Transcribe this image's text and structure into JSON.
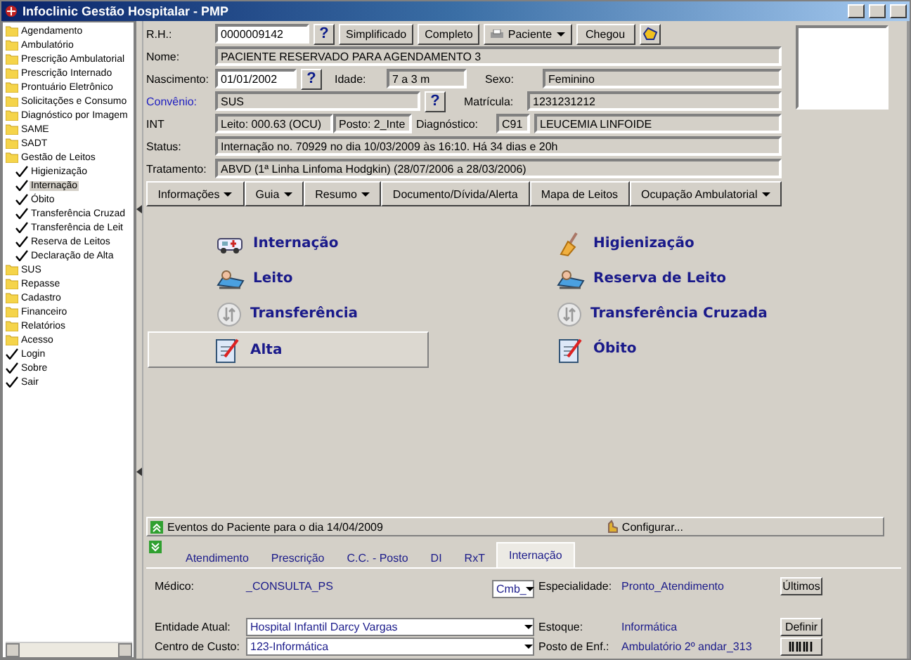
{
  "window": {
    "title": "Infoclinic Gestão Hospitalar - PMP"
  },
  "sidebar": {
    "items": [
      {
        "label": "Agendamento",
        "kind": "folder",
        "selected": false
      },
      {
        "label": "Ambulatório",
        "kind": "folder",
        "selected": false
      },
      {
        "label": "Prescrição Ambulatorial",
        "kind": "folder",
        "selected": false
      },
      {
        "label": "Prescrição Internado",
        "kind": "folder",
        "selected": false
      },
      {
        "label": "Prontuário Eletrônico",
        "kind": "folder",
        "selected": false
      },
      {
        "label": "Solicitações e Consumo",
        "kind": "folder",
        "selected": false
      },
      {
        "label": "Diagnóstico por Imagem",
        "kind": "folder",
        "selected": false
      },
      {
        "label": "SAME",
        "kind": "folder",
        "selected": false
      },
      {
        "label": "SADT",
        "kind": "folder",
        "selected": false
      },
      {
        "label": "Gestão de Leitos",
        "kind": "folder",
        "selected": false,
        "children": [
          {
            "label": "Higienização",
            "kind": "action",
            "selected": false
          },
          {
            "label": "Internação",
            "kind": "action",
            "selected": true
          },
          {
            "label": "Óbito",
            "kind": "action",
            "selected": false
          },
          {
            "label": "Transferência Cruzad",
            "kind": "action",
            "selected": false
          },
          {
            "label": "Transferência de Leit",
            "kind": "action",
            "selected": false
          },
          {
            "label": "Reserva de Leitos",
            "kind": "action",
            "selected": false
          },
          {
            "label": "Declaração de Alta",
            "kind": "action",
            "selected": false
          }
        ]
      },
      {
        "label": "SUS",
        "kind": "folder",
        "selected": false
      },
      {
        "label": "Repasse",
        "kind": "folder",
        "selected": false
      },
      {
        "label": "Cadastro",
        "kind": "folder",
        "selected": false
      },
      {
        "label": "Financeiro",
        "kind": "folder",
        "selected": false
      },
      {
        "label": "Relatórios",
        "kind": "folder",
        "selected": false
      },
      {
        "label": "Acesso",
        "kind": "folder",
        "selected": false
      },
      {
        "label": "Login",
        "kind": "action",
        "selected": false
      },
      {
        "label": "Sobre",
        "kind": "action",
        "selected": false
      },
      {
        "label": "Sair",
        "kind": "action",
        "selected": false
      }
    ]
  },
  "patient": {
    "rh_label": "R.H.:",
    "rh": "0000009142",
    "help": "?",
    "buttons": {
      "simplified": "Simplificado",
      "complete": "Completo",
      "patient": "Paciente",
      "arrived": "Chegou"
    },
    "name_label": "Nome:",
    "name": "PACIENTE RESERVADO PARA AGENDAMENTO 3",
    "birth_label": "Nascimento:",
    "birth": "01/01/2002",
    "age_label": "Idade:",
    "age": "7 a 3 m",
    "sex_label": "Sexo:",
    "sex": "Feminino",
    "insurance_label": "Convênio:",
    "insurance": "SUS",
    "registration_label": "Matrícula:",
    "registration": "1231231212",
    "int_label": "INT",
    "bed": "Leito: 000.63 (OCU)",
    "post": "Posto: 2_Inte",
    "diagnosis_label": "Diagnóstico:",
    "diagnosis_code": "C91",
    "diagnosis": "LEUCEMIA LINFOIDE",
    "status_label": "Status:",
    "status": "Internação no. 70929 no dia 10/03/2009  às  16:10. Há 34 dias e 20h",
    "treatment_label": "Tratamento:",
    "treatment": "ABVD (1ª Linha Linfoma Hodgkin) (28/07/2006 a 28/03/2006)"
  },
  "toolbar": [
    {
      "label": "Informações",
      "dropdown": true
    },
    {
      "label": "Guia",
      "dropdown": true
    },
    {
      "label": "Resumo",
      "dropdown": true
    },
    {
      "label": "Documento/Dívida/Alerta",
      "dropdown": false
    },
    {
      "label": "Mapa de Leitos",
      "dropdown": false
    },
    {
      "label": "Ocupação Ambulatorial",
      "dropdown": true
    }
  ],
  "actions": [
    {
      "label": "Internação",
      "kind": "ambulance",
      "highlighted": false
    },
    {
      "label": "Higienização",
      "kind": "broom",
      "highlighted": false
    },
    {
      "label": "Leito",
      "kind": "bed",
      "highlighted": false
    },
    {
      "label": "Reserva de Leito",
      "kind": "bed",
      "highlighted": false
    },
    {
      "label": "Transferência",
      "kind": "transfer",
      "highlighted": false
    },
    {
      "label": "Transferência Cruzada",
      "kind": "transfer",
      "highlighted": false
    },
    {
      "label": "Alta",
      "kind": "clipboard",
      "highlighted": true
    },
    {
      "label": "Óbito",
      "kind": "clipboard",
      "highlighted": false
    }
  ],
  "events_bar": {
    "text": "Eventos do Paciente para o dia 14/04/2009",
    "configure": "Configurar..."
  },
  "tabs": [
    {
      "label": "Atendimento",
      "selected": false
    },
    {
      "label": "Prescrição",
      "selected": false
    },
    {
      "label": "C.C. - Posto",
      "selected": false
    },
    {
      "label": "DI",
      "selected": false
    },
    {
      "label": "RxT",
      "selected": false
    },
    {
      "label": "Internação",
      "selected": true
    }
  ],
  "details": {
    "doctor_label": "Médico:",
    "doctor": "_CONSULTA_PS",
    "doctor_select": "Cmb_",
    "specialty_label": "Especialidade:",
    "specialty": "Pronto_Atendimento",
    "recent_button": "Últimos",
    "entity_label": "Entidade Atual:",
    "entity": "Hospital Infantil Darcy Vargas",
    "stock_label": "Estoque:",
    "stock": "Informática",
    "define_button": "Definir",
    "cost_label": "Centro de Custo:",
    "cost": "123-Informática",
    "nurse_label": "Posto de Enf.:",
    "nurse": "Ambulatório 2º andar_313"
  }
}
